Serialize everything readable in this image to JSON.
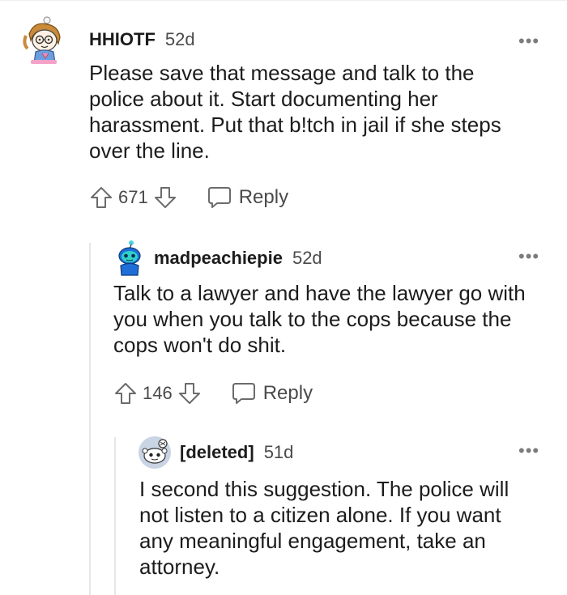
{
  "comments": [
    {
      "username": "HHIOTF",
      "age": "52d",
      "more_label": "•••",
      "body_lines": [
        "Please save that message and talk to the",
        "police about it. Start documenting her",
        "harassment. Put that b!tch in jail if she steps",
        "over the line."
      ],
      "score": "671",
      "reply_label": "Reply",
      "avatar_icon": "cartoon-girl-avatar-icon"
    },
    {
      "username": "madpeachiepie",
      "age": "52d",
      "more_label": "•••",
      "body_lines": [
        "Talk to a lawyer and have the lawyer go with",
        "you when you talk to the cops because the",
        "cops won't do shit."
      ],
      "score": "146",
      "reply_label": "Reply",
      "avatar_icon": "blue-snoo-avatar-icon"
    },
    {
      "username": "[deleted]",
      "age": "51d",
      "more_label": "•••",
      "body_lines": [
        "I second this suggestion. The police will",
        "not listen to a citizen alone. If you want",
        "any meaningful engagement, take an",
        "attorney."
      ],
      "avatar_icon": "default-snoo-avatar-icon"
    }
  ],
  "colors": {
    "text": "#1c1c1c",
    "meta": "#4a4a4a",
    "icon": "#6b6b6b",
    "thread_line": "#e4e6e8"
  }
}
